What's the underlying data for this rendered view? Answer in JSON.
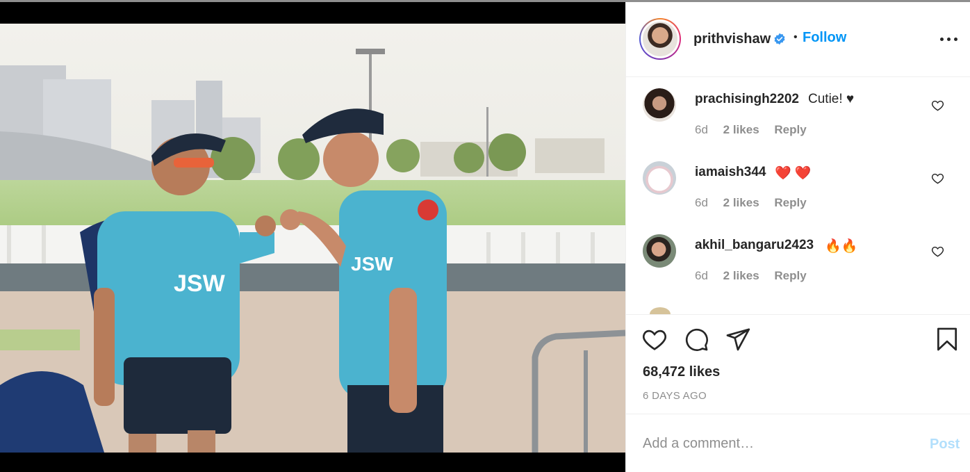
{
  "post": {
    "image_description_icon": "photo-image",
    "username": "prithvishaw",
    "verified": true,
    "separator": "•",
    "follow_label": "Follow",
    "more_icon": "more-horizontal-icon",
    "likes": "68,472 likes",
    "time_ago": "6 DAYS AGO"
  },
  "comments": [
    {
      "user": "prachisingh2202",
      "text": "Cutie! ♥",
      "age": "6d",
      "likes": "2 likes",
      "reply_label": "Reply"
    },
    {
      "user": "iamaish344",
      "text": "❤️ ❤️",
      "age": "6d",
      "likes": "2 likes",
      "reply_label": "Reply"
    },
    {
      "user": "akhil_bangaru2423",
      "text": "🔥🔥",
      "age": "6d",
      "likes": "2 likes",
      "reply_label": "Reply"
    }
  ],
  "comment_box": {
    "placeholder": "Add a comment…",
    "post_label": "Post"
  },
  "colors": {
    "link": "#0095f6",
    "post_disabled": "#b2dffc",
    "muted": "#8e8e8e",
    "text": "#262626"
  }
}
